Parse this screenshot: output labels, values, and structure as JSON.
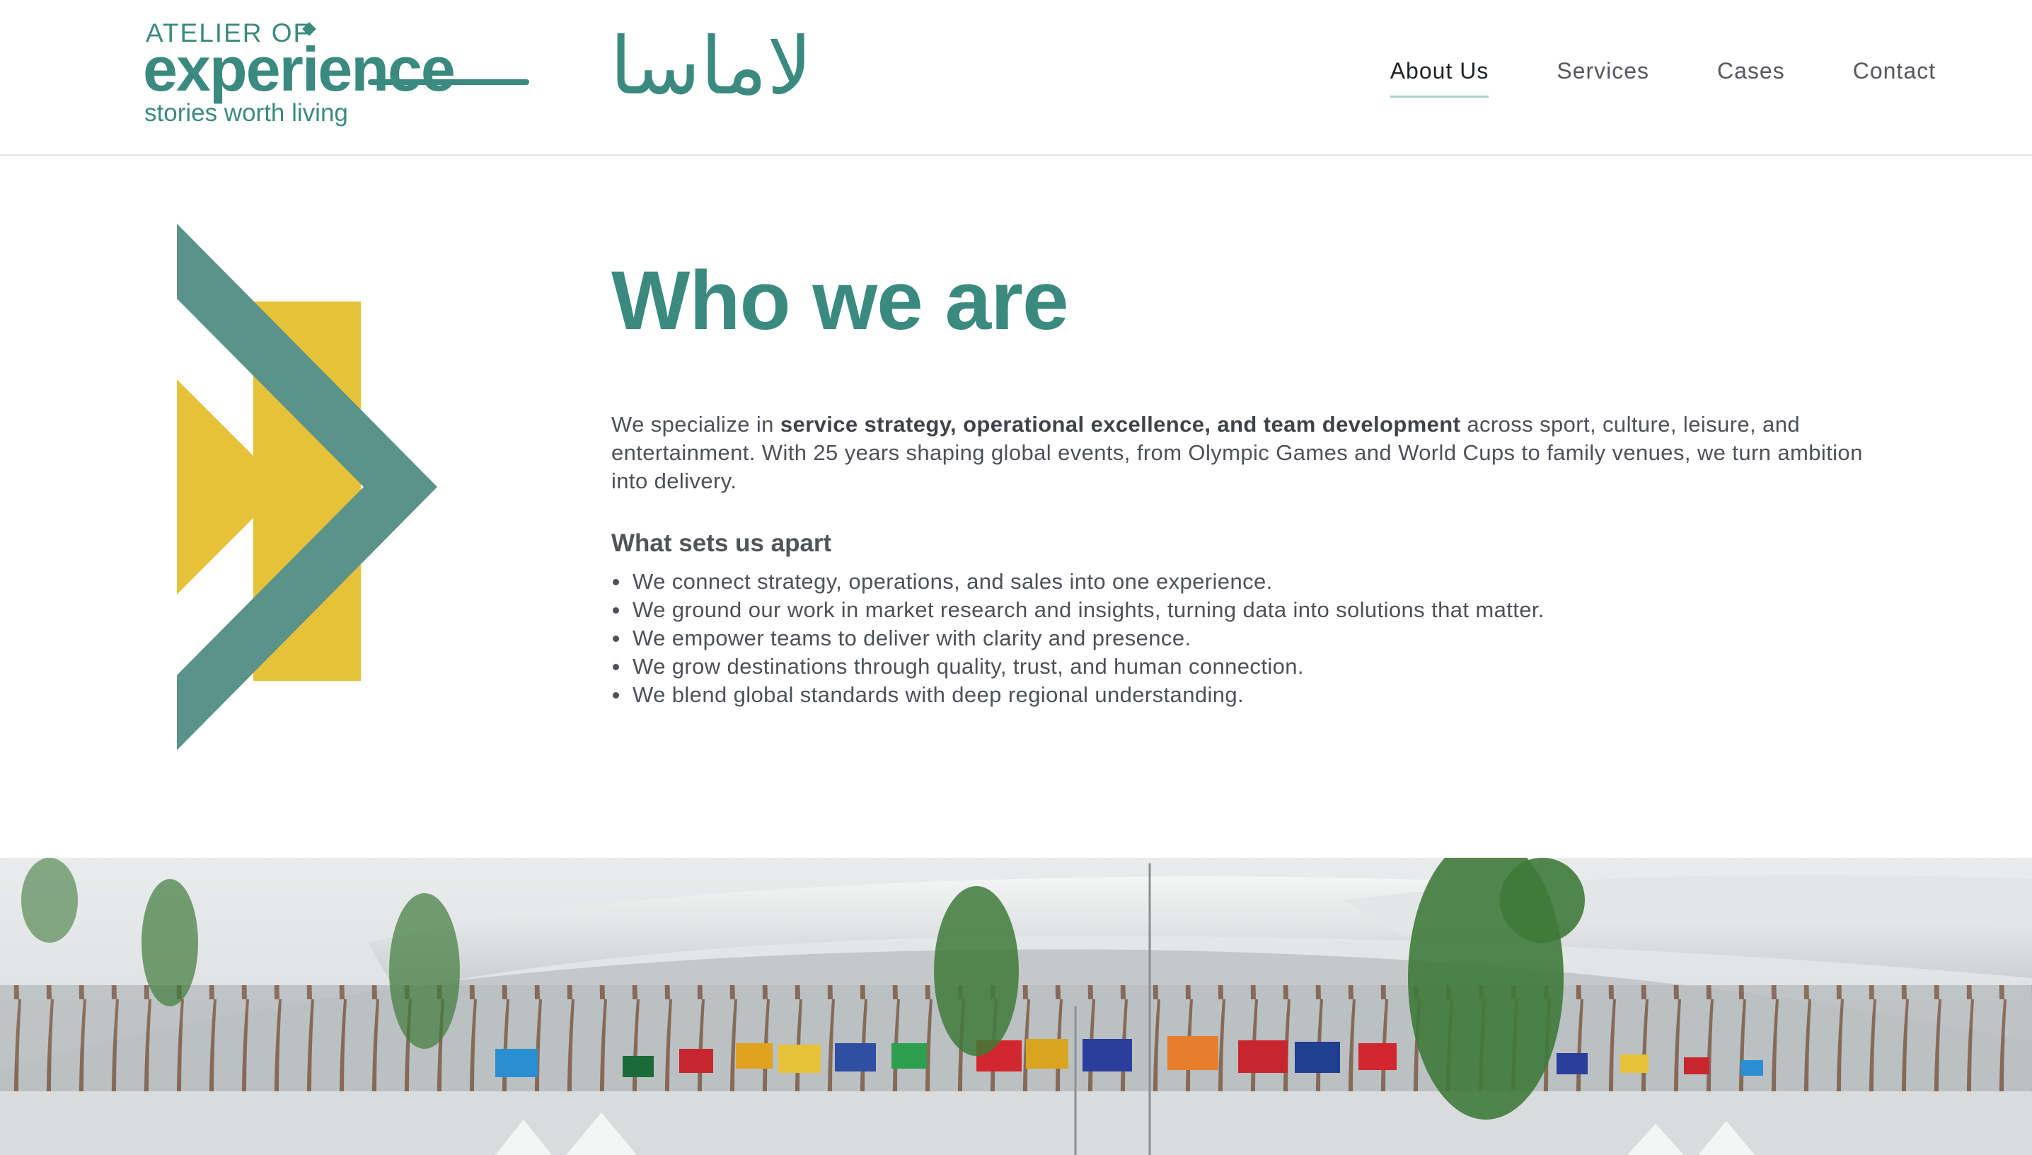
{
  "brand": {
    "atelier": "ATELIER OF",
    "experience": "experience",
    "tagline": "stories worth living",
    "arabic": "لاماسا",
    "color": "#3b8a80"
  },
  "nav": [
    {
      "label": "About Us",
      "active": true
    },
    {
      "label": "Services",
      "active": false
    },
    {
      "label": "Cases",
      "active": false
    },
    {
      "label": "Contact",
      "active": false
    }
  ],
  "graphic": {
    "teal": "#5a9389",
    "yellow": "#e6c23a"
  },
  "about": {
    "title": "Who we are",
    "intro_prefix": "We specialize in ",
    "intro_bold": "service strategy, operational excellence, and team development",
    "intro_suffix": " across sport, culture, leisure, and entertainment. With 25 years shaping global events, from Olympic Games and World Cups to family venues, we turn ambition into delivery.",
    "subheading": "What sets us apart",
    "points": [
      "We connect strategy, operations, and sales into one experience.",
      "We ground our work in market research and insights, turning data into solutions that matter.",
      "We empower teams to deliver with clarity and presence.",
      "We grow destinations through quality, trust, and human connection.",
      "We blend global standards with deep regional understanding."
    ]
  },
  "hero": {
    "description": "stadium-with-flags-photo"
  }
}
